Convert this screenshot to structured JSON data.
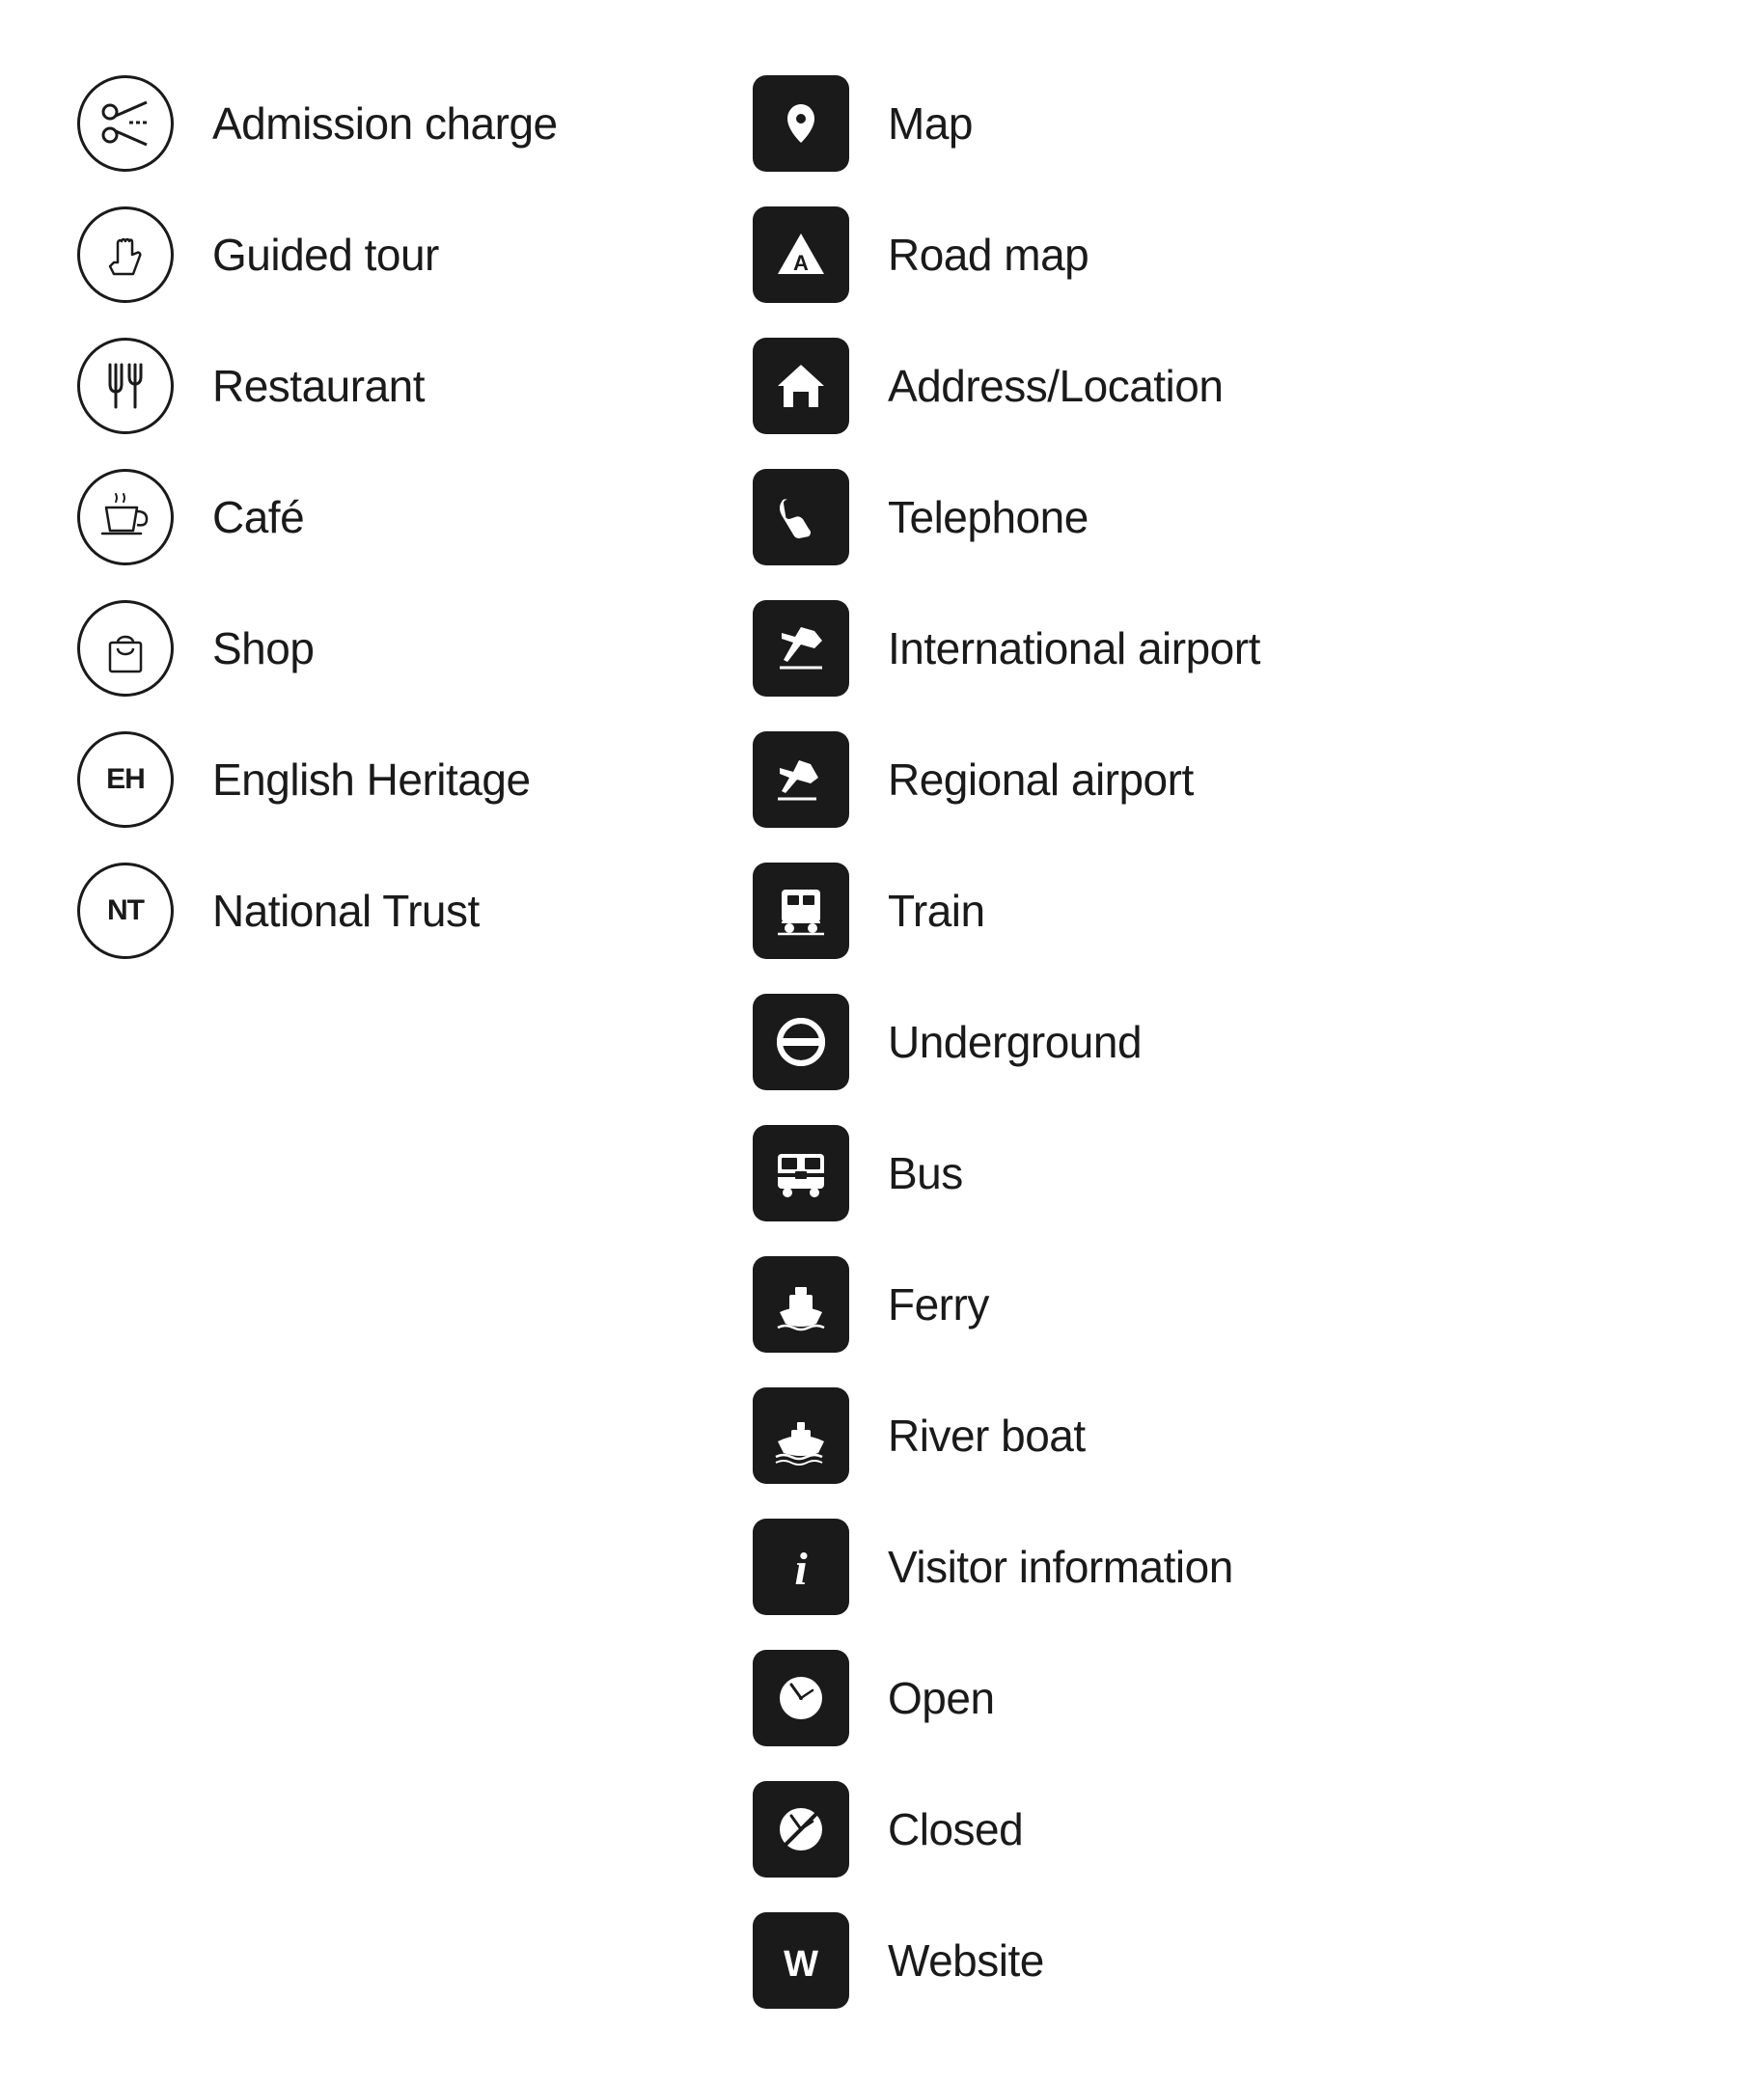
{
  "left_column": [
    {
      "id": "admission-charge",
      "label": "Admission charge",
      "icon_type": "circle",
      "icon_name": "admission-charge-icon"
    },
    {
      "id": "guided-tour",
      "label": "Guided tour",
      "icon_type": "circle",
      "icon_name": "guided-tour-icon"
    },
    {
      "id": "restaurant",
      "label": "Restaurant",
      "icon_type": "circle",
      "icon_name": "restaurant-icon"
    },
    {
      "id": "cafe",
      "label": "Café",
      "icon_type": "circle",
      "icon_name": "cafe-icon"
    },
    {
      "id": "shop",
      "label": "Shop",
      "icon_type": "circle",
      "icon_name": "shop-icon"
    },
    {
      "id": "english-heritage",
      "label": "English Heritage",
      "icon_type": "circle",
      "icon_name": "english-heritage-icon"
    },
    {
      "id": "national-trust",
      "label": "National Trust",
      "icon_type": "circle",
      "icon_name": "national-trust-icon"
    }
  ],
  "right_column": [
    {
      "id": "map",
      "label": "Map",
      "icon_type": "square",
      "icon_name": "map-icon"
    },
    {
      "id": "road-map",
      "label": "Road map",
      "icon_type": "square",
      "icon_name": "road-map-icon"
    },
    {
      "id": "address-location",
      "label": "Address/Location",
      "icon_type": "square",
      "icon_name": "address-location-icon"
    },
    {
      "id": "telephone",
      "label": "Telephone",
      "icon_type": "square",
      "icon_name": "telephone-icon"
    },
    {
      "id": "international-airport",
      "label": "International airport",
      "icon_type": "square",
      "icon_name": "international-airport-icon"
    },
    {
      "id": "regional-airport",
      "label": "Regional airport",
      "icon_type": "square",
      "icon_name": "regional-airport-icon"
    },
    {
      "id": "train",
      "label": "Train",
      "icon_type": "square",
      "icon_name": "train-icon"
    },
    {
      "id": "underground",
      "label": "Underground",
      "icon_type": "square",
      "icon_name": "underground-icon"
    },
    {
      "id": "bus",
      "label": "Bus",
      "icon_type": "square",
      "icon_name": "bus-icon"
    },
    {
      "id": "ferry",
      "label": "Ferry",
      "icon_type": "square",
      "icon_name": "ferry-icon"
    },
    {
      "id": "river-boat",
      "label": "River boat",
      "icon_type": "square",
      "icon_name": "river-boat-icon"
    },
    {
      "id": "visitor-information",
      "label": "Visitor information",
      "icon_type": "square",
      "icon_name": "visitor-information-icon"
    },
    {
      "id": "open",
      "label": "Open",
      "icon_type": "square",
      "icon_name": "open-icon"
    },
    {
      "id": "closed",
      "label": "Closed",
      "icon_type": "square",
      "icon_name": "closed-icon"
    },
    {
      "id": "website",
      "label": "Website",
      "icon_type": "square",
      "icon_name": "website-icon"
    }
  ]
}
